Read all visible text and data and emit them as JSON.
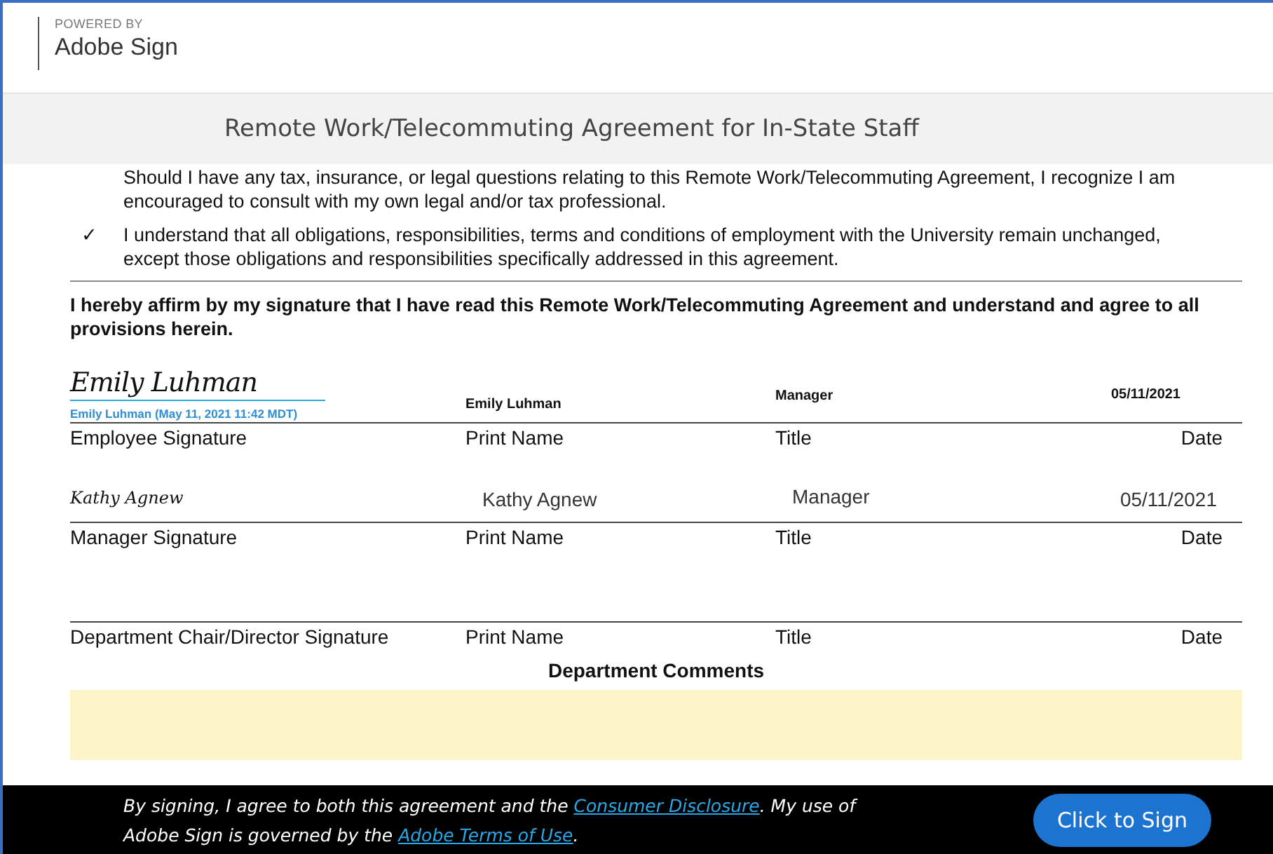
{
  "header": {
    "powered_by": "POWERED BY",
    "brand": "Adobe Sign"
  },
  "document_title": "Remote Work/Telecommuting Agreement for In-State Staff",
  "clauses": [
    {
      "kind": "plain",
      "text": "Should I have any tax, insurance, or legal questions relating to this Remote Work/Telecommuting Agreement, I recognize I am encouraged to consult with my own legal and/or tax professional."
    },
    {
      "kind": "checked",
      "mark": "✓",
      "text": "I understand that all obligations, responsibilities, terms and conditions of employment with the University remain unchanged, except those obligations and responsibilities specifically addressed in this agreement."
    }
  ],
  "affirmation": "I hereby affirm by my signature that I have read this Remote Work/Telecommuting Agreement and understand and agree to all provisions herein.",
  "signature_rows": [
    {
      "kind": "esign",
      "signature": "Emily Luhman",
      "stamp": "Emily Luhman (May 11, 2021 11:42 MDT)",
      "print_name": "Emily Luhman",
      "title": "Manager",
      "date": "05/11/2021",
      "labels": [
        "Employee Signature",
        "Print Name",
        "Title",
        "Date"
      ]
    },
    {
      "kind": "typed",
      "signature": "Kathy Agnew",
      "print_name": "Kathy Agnew",
      "title": "Manager",
      "date": "05/11/2021",
      "labels": [
        "Manager Signature",
        "Print Name",
        "Title",
        "Date"
      ]
    },
    {
      "kind": "blank",
      "labels": [
        "Department Chair/Director Signature",
        "Print Name",
        "Title",
        "Date"
      ]
    }
  ],
  "comments_heading": "Department Comments",
  "footer": {
    "parts": [
      {
        "kind": "text",
        "text": "By signing, I agree to both this agreement and the "
      },
      {
        "kind": "link",
        "text": "Consumer Disclosure"
      },
      {
        "kind": "text",
        "text": ". My use of Adobe Sign is governed by the "
      },
      {
        "kind": "link",
        "text": "Adobe Terms of Use"
      },
      {
        "kind": "text",
        "text": "."
      }
    ],
    "button": "Click to Sign"
  }
}
